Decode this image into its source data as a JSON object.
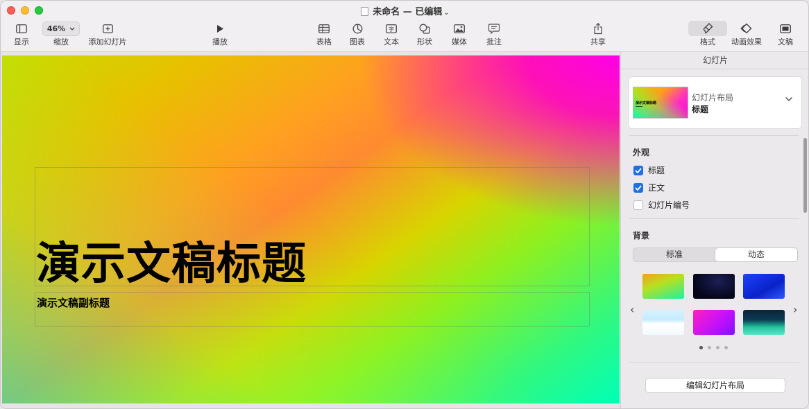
{
  "window": {
    "title": "未命名 — 已编辑"
  },
  "toolbar": {
    "view_label": "显示",
    "zoom_value": "46%",
    "zoom_label": "缩放",
    "add_slide_label": "添加幻灯片",
    "play_label": "播放",
    "table_label": "表格",
    "chart_label": "图表",
    "text_label": "文本",
    "shape_label": "形状",
    "media_label": "媒体",
    "comment_label": "批注",
    "share_label": "共享",
    "format_label": "格式",
    "animate_label": "动画效果",
    "document_label": "文稿"
  },
  "slide": {
    "title": "演示文稿标题",
    "subtitle": "演示文稿副标题"
  },
  "inspector": {
    "header": "幻灯片",
    "layout_label": "幻灯片布局",
    "layout_value": "标题",
    "thumb_title": "演示文稿标题",
    "appearance_title": "外观",
    "appearance_items": [
      {
        "label": "标题",
        "checked": true
      },
      {
        "label": "正文",
        "checked": true
      },
      {
        "label": "幻灯片编号",
        "checked": false
      }
    ],
    "background_title": "背景",
    "bg_tabs": [
      "标准",
      "动态"
    ],
    "bg_active_tab": "动态",
    "page_dots": 4,
    "page_active": 1,
    "edit_layout_button": "编辑幻灯片布局"
  },
  "colors": {
    "accent": "#1f6fe5",
    "close": "#fe5f57",
    "minimize": "#febc2e",
    "zoom": "#28c840"
  }
}
